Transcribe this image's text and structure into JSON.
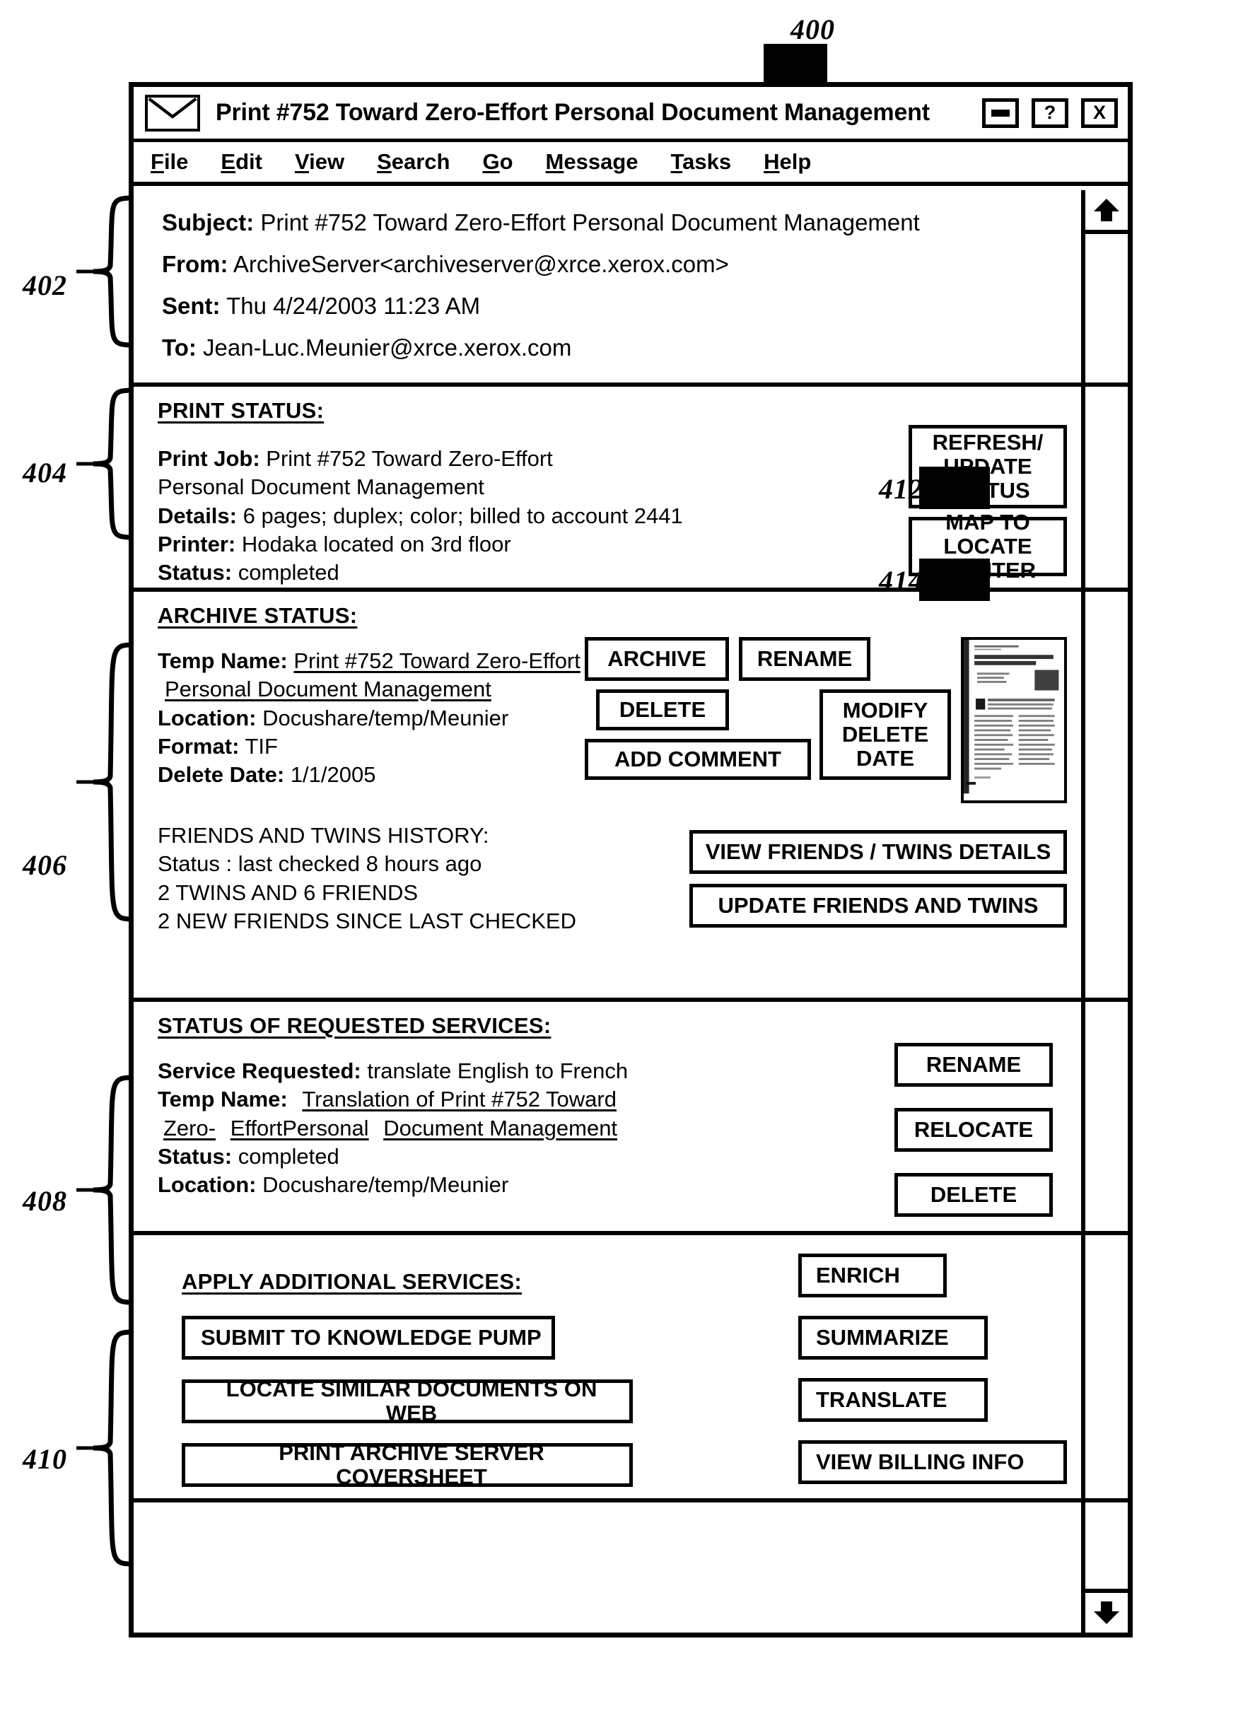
{
  "figure": {
    "number": "400",
    "callouts": [
      {
        "id": "402",
        "label": "402"
      },
      {
        "id": "404",
        "label": "404"
      },
      {
        "id": "406",
        "label": "406"
      },
      {
        "id": "408",
        "label": "408"
      },
      {
        "id": "410",
        "label": "410"
      },
      {
        "id": "412",
        "label": "412"
      },
      {
        "id": "414",
        "label": "414"
      }
    ]
  },
  "window": {
    "title": "Print #752 Toward Zero-Effort Personal Document Management",
    "icon": "envelope-icon",
    "controls": {
      "minimize": "minimize-icon",
      "help": "?",
      "close": "X"
    },
    "menu": [
      {
        "label": "File",
        "accel": "F"
      },
      {
        "label": "Edit",
        "accel": "E"
      },
      {
        "label": "View",
        "accel": "V"
      },
      {
        "label": "Search",
        "accel": "S"
      },
      {
        "label": "Go",
        "accel": "G"
      },
      {
        "label": "Message",
        "accel": "M"
      },
      {
        "label": "Tasks",
        "accel": "T"
      },
      {
        "label": "Help",
        "accel": "H"
      }
    ]
  },
  "headers": {
    "subject_label": "Subject:",
    "subject_value": "Print #752 Toward Zero-Effort Personal Document Management",
    "from_label": "From:",
    "from_value": "ArchiveServer<archiveserver@xrce.xerox.com>",
    "sent_label": "Sent:",
    "sent_value": "Thu 4/24/2003 11:23 AM",
    "to_label": "To:",
    "to_value": "Jean-Luc.Meunier@xrce.xerox.com"
  },
  "print_status": {
    "heading": "PRINT STATUS:",
    "print_job_label": "Print Job:",
    "print_job_value_line1": "Print #752 Toward Zero-Effort",
    "print_job_value_line2": "Personal Document Management",
    "details_label": "Details:",
    "details_value": "6 pages; duplex; color; billed to account 2441",
    "printer_label": "Printer:",
    "printer_value": "Hodaka located on 3rd floor",
    "status_label": "Status:",
    "status_value": "completed",
    "buttons": {
      "refresh": "REFRESH/\nUPDATE\nSTATUS",
      "map": "MAP TO LOCATE\nPRINTER"
    }
  },
  "archive_status": {
    "heading": "ARCHIVE STATUS:",
    "temp_name_label": "Temp Name:",
    "temp_name_line1": "Print #752 Toward Zero-Effort",
    "temp_name_line2": "Personal Document Management",
    "location_label": "Location:",
    "location_value": "Docushare/temp/Meunier",
    "format_label": "Format:",
    "format_value": "TIF",
    "delete_date_label": "Delete Date:",
    "delete_date_value": "1/1/2005",
    "buttons": {
      "archive": "ARCHIVE",
      "rename": "RENAME",
      "delete": "DELETE",
      "modify_delete_date": "MODIFY\nDELETE\nDATE",
      "add_comment": "ADD COMMENT"
    },
    "thumbnail": {
      "name": "document-thumbnail",
      "title_line1": "Toward Zero-Effort Personal",
      "title_line2": "Document Management"
    },
    "friends_twins": {
      "heading": "FRIENDS AND TWINS HISTORY:",
      "status_line": "Status : last checked 8 hours ago",
      "counts_line": "2 TWINS AND 6 FRIENDS",
      "new_line": "2 NEW FRIENDS SINCE LAST CHECKED",
      "buttons": {
        "view": "VIEW FRIENDS / TWINS DETAILS",
        "update": "UPDATE FRIENDS AND TWINS"
      }
    }
  },
  "requested_services": {
    "heading": "STATUS OF REQUESTED SERVICES:",
    "service_requested_label": "Service Requested:",
    "service_requested_value": "translate English to French",
    "temp_name_label": "Temp Name:",
    "temp_name_line1": "Translation of Print #752 Toward",
    "temp_name_line2_a": "Zero-",
    "temp_name_line2_b": "EffortPersonal",
    "temp_name_line2_c": "Document Management",
    "status_label": "Status:",
    "status_value": "completed",
    "location_label": "Location:",
    "location_value": "Docushare/temp/Meunier",
    "buttons": {
      "rename": "RENAME",
      "relocate": "RELOCATE",
      "delete": "DELETE"
    }
  },
  "additional_services": {
    "heading": "APPLY ADDITIONAL SERVICES:",
    "left_buttons": [
      "SUBMIT TO KNOWLEDGE PUMP",
      "LOCATE SIMILAR DOCUMENTS ON WEB",
      "PRINT ARCHIVE SERVER COVERSHEET"
    ],
    "right_buttons": [
      "ENRICH",
      "SUMMARIZE",
      "TRANSLATE",
      "VIEW BILLING INFO"
    ]
  },
  "scrollbar": {
    "up": "scroll-up-icon",
    "down": "scroll-down-icon"
  }
}
